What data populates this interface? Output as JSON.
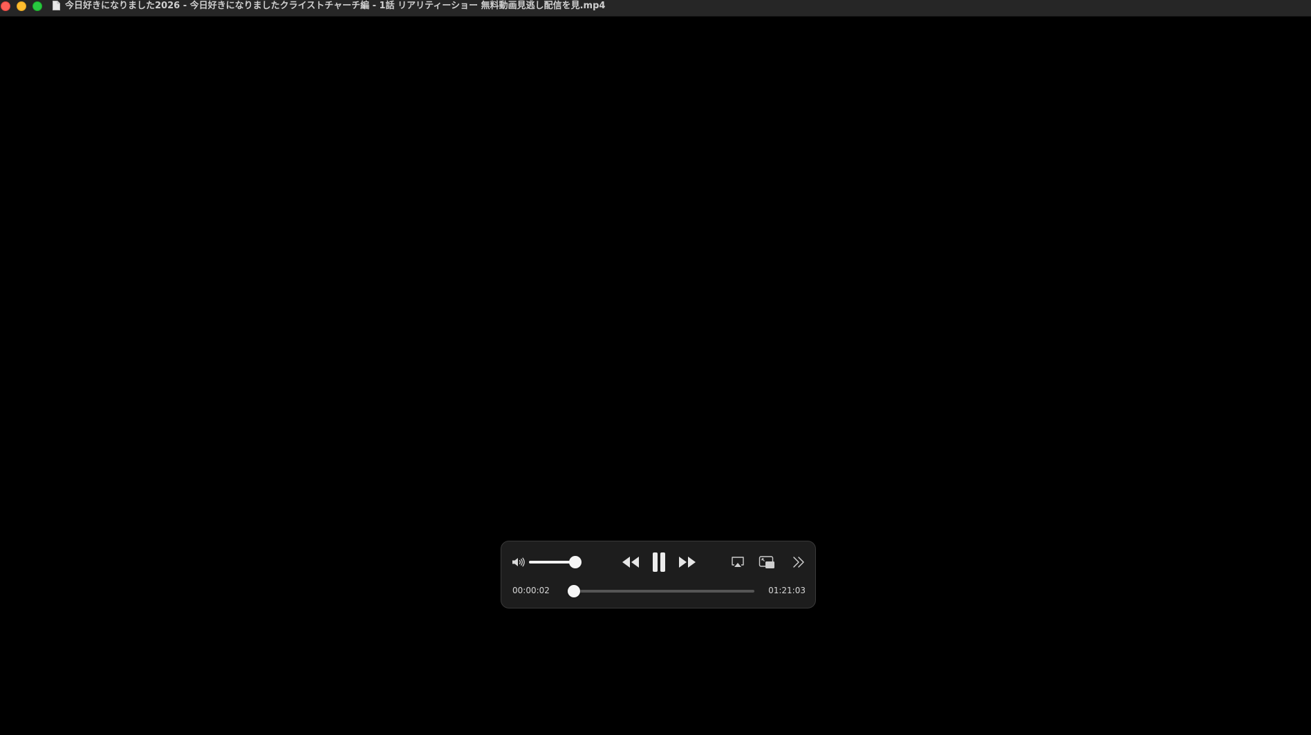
{
  "window": {
    "title": "今日好きになりました2026 - 今日好きになりましたクライストチャーチ編 - 1話 リアリティーショー 無料動画見逃し配信を見.mp4",
    "traffic_lights": {
      "close": "#fe5f57",
      "minimize": "#febc2e",
      "zoom": "#28c840"
    },
    "title_icon": "document-icon"
  },
  "player": {
    "state": "playing",
    "volume_level": 0.88,
    "elapsed": "00:00:02",
    "duration": "01:21:03",
    "progress_fraction": 0.0004,
    "controls": {
      "volume_icon": "speaker-icon",
      "rewind_icon": "rewind-icon",
      "pause_icon": "pause-icon",
      "forward_icon": "fast-forward-icon",
      "airplay_icon": "airplay-icon",
      "pip_icon": "picture-in-picture-icon",
      "more_icon": "more-chevron-icon"
    }
  }
}
